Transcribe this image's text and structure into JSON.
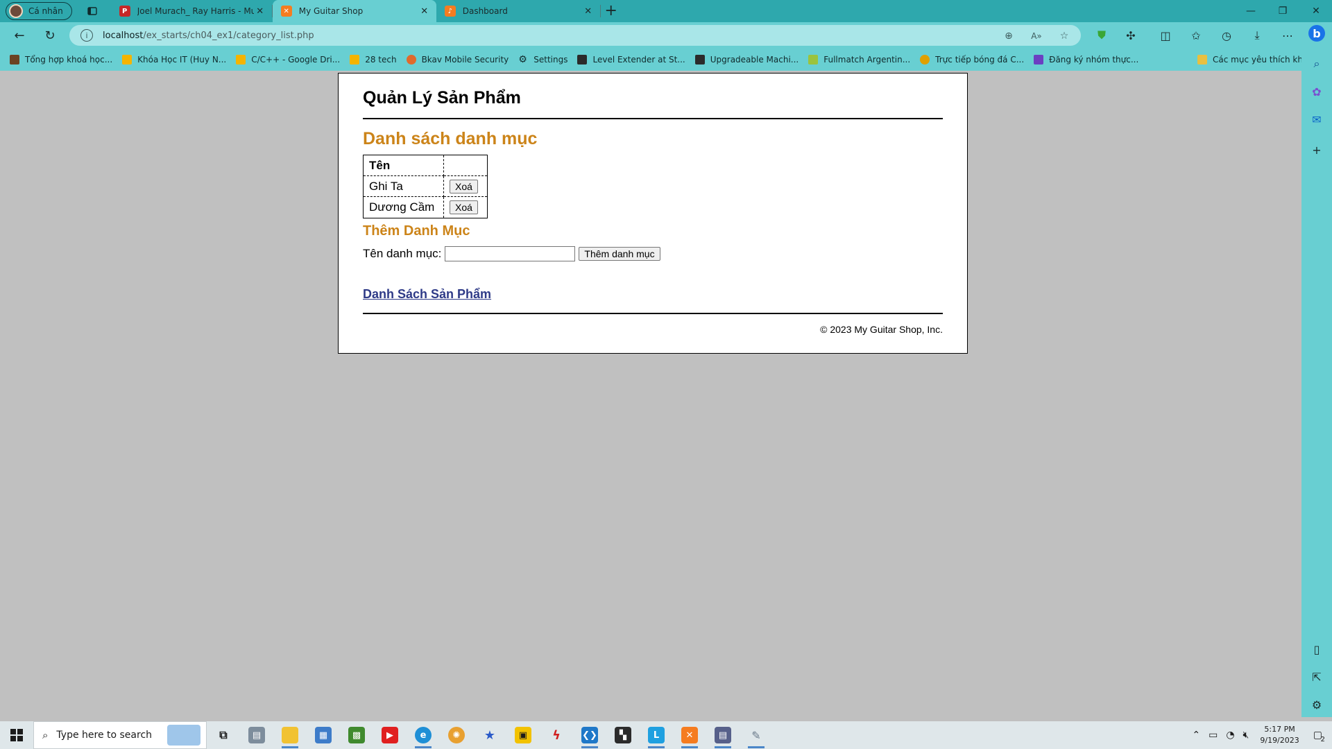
{
  "browser": {
    "profile_label": "Cá nhân",
    "tabs": [
      {
        "title": "Joel Murach_ Ray Harris - Murach",
        "favicon": "pdf-icon",
        "active": false
      },
      {
        "title": "My Guitar Shop",
        "favicon": "xampp-icon",
        "active": true
      },
      {
        "title": "Dashboard",
        "favicon": "xampp-dashboard-icon",
        "active": false
      }
    ],
    "url_host": "localhost",
    "url_path": "/ex_starts/ch04_ex1/category_list.php",
    "bookmarks": [
      {
        "label": "Tổng hợp khoá học...",
        "icon": "bookmark-icon",
        "color": "#6b4423"
      },
      {
        "label": "Khóa Học IT (Huy N...",
        "icon": "google-drive-icon",
        "color": "#f4b400"
      },
      {
        "label": "C/C++ - Google Dri...",
        "icon": "google-drive-icon",
        "color": "#f4b400"
      },
      {
        "label": "28 tech",
        "icon": "google-drive-icon",
        "color": "#f4b400"
      },
      {
        "label": "Bkav Mobile Security",
        "icon": "bkav-icon",
        "color": "#e06a2c"
      },
      {
        "label": "Settings",
        "icon": "gear-icon",
        "color": "#3a4a4b"
      },
      {
        "label": "Level Extender at St...",
        "icon": "game-icon",
        "color": "#2b2b2b"
      },
      {
        "label": "Upgradeable Machi...",
        "icon": "game-icon",
        "color": "#2b2b2b"
      },
      {
        "label": "Fullmatch Argentin...",
        "icon": "football-icon",
        "color": "#9bc33d"
      },
      {
        "label": "Trực tiếp bóng đá C...",
        "icon": "football-icon",
        "color": "#e0a000"
      },
      {
        "label": "Đăng ký nhóm thực...",
        "icon": "form-icon",
        "color": "#6b3fc2"
      }
    ],
    "other_bookmarks_label": "Các mục yêu thích khác"
  },
  "page": {
    "header_title": "Quản Lý Sản Phẩm",
    "list_heading": "Danh sách danh mục",
    "table_header": {
      "name": "Tên",
      "action": ""
    },
    "categories": [
      {
        "name": "Ghi Ta",
        "delete_label": "Xoá"
      },
      {
        "name": "Dương Cầm",
        "delete_label": "Xoá"
      }
    ],
    "add_heading": "Thêm Danh Mục",
    "field_label": "Tên danh mục:",
    "field_value": "",
    "add_button_label": "Thêm danh mục",
    "product_list_link": "Danh Sách Sản Phẩm",
    "footer": "© 2023 My Guitar Shop, Inc."
  },
  "taskbar": {
    "search_placeholder": "Type here to search",
    "time": "5:17 PM",
    "date": "9/19/2023",
    "notification_count": "2"
  },
  "colors": {
    "heading_accent": "#cc8419",
    "link": "#2e3a87",
    "browser_chrome": "#68cfd2",
    "tab_strip": "#2ea8ad"
  }
}
